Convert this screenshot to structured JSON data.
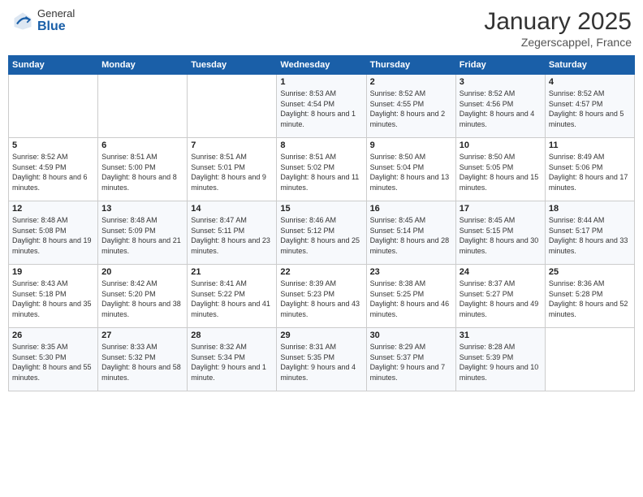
{
  "logo": {
    "general": "General",
    "blue": "Blue"
  },
  "header": {
    "title": "January 2025",
    "location": "Zegerscappel, France"
  },
  "weekdays": [
    "Sunday",
    "Monday",
    "Tuesday",
    "Wednesday",
    "Thursday",
    "Friday",
    "Saturday"
  ],
  "weeks": [
    [
      {
        "day": "",
        "sunrise": "",
        "sunset": "",
        "daylight": ""
      },
      {
        "day": "",
        "sunrise": "",
        "sunset": "",
        "daylight": ""
      },
      {
        "day": "",
        "sunrise": "",
        "sunset": "",
        "daylight": ""
      },
      {
        "day": "1",
        "sunrise": "Sunrise: 8:53 AM",
        "sunset": "Sunset: 4:54 PM",
        "daylight": "Daylight: 8 hours and 1 minute."
      },
      {
        "day": "2",
        "sunrise": "Sunrise: 8:52 AM",
        "sunset": "Sunset: 4:55 PM",
        "daylight": "Daylight: 8 hours and 2 minutes."
      },
      {
        "day": "3",
        "sunrise": "Sunrise: 8:52 AM",
        "sunset": "Sunset: 4:56 PM",
        "daylight": "Daylight: 8 hours and 4 minutes."
      },
      {
        "day": "4",
        "sunrise": "Sunrise: 8:52 AM",
        "sunset": "Sunset: 4:57 PM",
        "daylight": "Daylight: 8 hours and 5 minutes."
      }
    ],
    [
      {
        "day": "5",
        "sunrise": "Sunrise: 8:52 AM",
        "sunset": "Sunset: 4:59 PM",
        "daylight": "Daylight: 8 hours and 6 minutes."
      },
      {
        "day": "6",
        "sunrise": "Sunrise: 8:51 AM",
        "sunset": "Sunset: 5:00 PM",
        "daylight": "Daylight: 8 hours and 8 minutes."
      },
      {
        "day": "7",
        "sunrise": "Sunrise: 8:51 AM",
        "sunset": "Sunset: 5:01 PM",
        "daylight": "Daylight: 8 hours and 9 minutes."
      },
      {
        "day": "8",
        "sunrise": "Sunrise: 8:51 AM",
        "sunset": "Sunset: 5:02 PM",
        "daylight": "Daylight: 8 hours and 11 minutes."
      },
      {
        "day": "9",
        "sunrise": "Sunrise: 8:50 AM",
        "sunset": "Sunset: 5:04 PM",
        "daylight": "Daylight: 8 hours and 13 minutes."
      },
      {
        "day": "10",
        "sunrise": "Sunrise: 8:50 AM",
        "sunset": "Sunset: 5:05 PM",
        "daylight": "Daylight: 8 hours and 15 minutes."
      },
      {
        "day": "11",
        "sunrise": "Sunrise: 8:49 AM",
        "sunset": "Sunset: 5:06 PM",
        "daylight": "Daylight: 8 hours and 17 minutes."
      }
    ],
    [
      {
        "day": "12",
        "sunrise": "Sunrise: 8:48 AM",
        "sunset": "Sunset: 5:08 PM",
        "daylight": "Daylight: 8 hours and 19 minutes."
      },
      {
        "day": "13",
        "sunrise": "Sunrise: 8:48 AM",
        "sunset": "Sunset: 5:09 PM",
        "daylight": "Daylight: 8 hours and 21 minutes."
      },
      {
        "day": "14",
        "sunrise": "Sunrise: 8:47 AM",
        "sunset": "Sunset: 5:11 PM",
        "daylight": "Daylight: 8 hours and 23 minutes."
      },
      {
        "day": "15",
        "sunrise": "Sunrise: 8:46 AM",
        "sunset": "Sunset: 5:12 PM",
        "daylight": "Daylight: 8 hours and 25 minutes."
      },
      {
        "day": "16",
        "sunrise": "Sunrise: 8:45 AM",
        "sunset": "Sunset: 5:14 PM",
        "daylight": "Daylight: 8 hours and 28 minutes."
      },
      {
        "day": "17",
        "sunrise": "Sunrise: 8:45 AM",
        "sunset": "Sunset: 5:15 PM",
        "daylight": "Daylight: 8 hours and 30 minutes."
      },
      {
        "day": "18",
        "sunrise": "Sunrise: 8:44 AM",
        "sunset": "Sunset: 5:17 PM",
        "daylight": "Daylight: 8 hours and 33 minutes."
      }
    ],
    [
      {
        "day": "19",
        "sunrise": "Sunrise: 8:43 AM",
        "sunset": "Sunset: 5:18 PM",
        "daylight": "Daylight: 8 hours and 35 minutes."
      },
      {
        "day": "20",
        "sunrise": "Sunrise: 8:42 AM",
        "sunset": "Sunset: 5:20 PM",
        "daylight": "Daylight: 8 hours and 38 minutes."
      },
      {
        "day": "21",
        "sunrise": "Sunrise: 8:41 AM",
        "sunset": "Sunset: 5:22 PM",
        "daylight": "Daylight: 8 hours and 41 minutes."
      },
      {
        "day": "22",
        "sunrise": "Sunrise: 8:39 AM",
        "sunset": "Sunset: 5:23 PM",
        "daylight": "Daylight: 8 hours and 43 minutes."
      },
      {
        "day": "23",
        "sunrise": "Sunrise: 8:38 AM",
        "sunset": "Sunset: 5:25 PM",
        "daylight": "Daylight: 8 hours and 46 minutes."
      },
      {
        "day": "24",
        "sunrise": "Sunrise: 8:37 AM",
        "sunset": "Sunset: 5:27 PM",
        "daylight": "Daylight: 8 hours and 49 minutes."
      },
      {
        "day": "25",
        "sunrise": "Sunrise: 8:36 AM",
        "sunset": "Sunset: 5:28 PM",
        "daylight": "Daylight: 8 hours and 52 minutes."
      }
    ],
    [
      {
        "day": "26",
        "sunrise": "Sunrise: 8:35 AM",
        "sunset": "Sunset: 5:30 PM",
        "daylight": "Daylight: 8 hours and 55 minutes."
      },
      {
        "day": "27",
        "sunrise": "Sunrise: 8:33 AM",
        "sunset": "Sunset: 5:32 PM",
        "daylight": "Daylight: 8 hours and 58 minutes."
      },
      {
        "day": "28",
        "sunrise": "Sunrise: 8:32 AM",
        "sunset": "Sunset: 5:34 PM",
        "daylight": "Daylight: 9 hours and 1 minute."
      },
      {
        "day": "29",
        "sunrise": "Sunrise: 8:31 AM",
        "sunset": "Sunset: 5:35 PM",
        "daylight": "Daylight: 9 hours and 4 minutes."
      },
      {
        "day": "30",
        "sunrise": "Sunrise: 8:29 AM",
        "sunset": "Sunset: 5:37 PM",
        "daylight": "Daylight: 9 hours and 7 minutes."
      },
      {
        "day": "31",
        "sunrise": "Sunrise: 8:28 AM",
        "sunset": "Sunset: 5:39 PM",
        "daylight": "Daylight: 9 hours and 10 minutes."
      },
      {
        "day": "",
        "sunrise": "",
        "sunset": "",
        "daylight": ""
      }
    ]
  ]
}
